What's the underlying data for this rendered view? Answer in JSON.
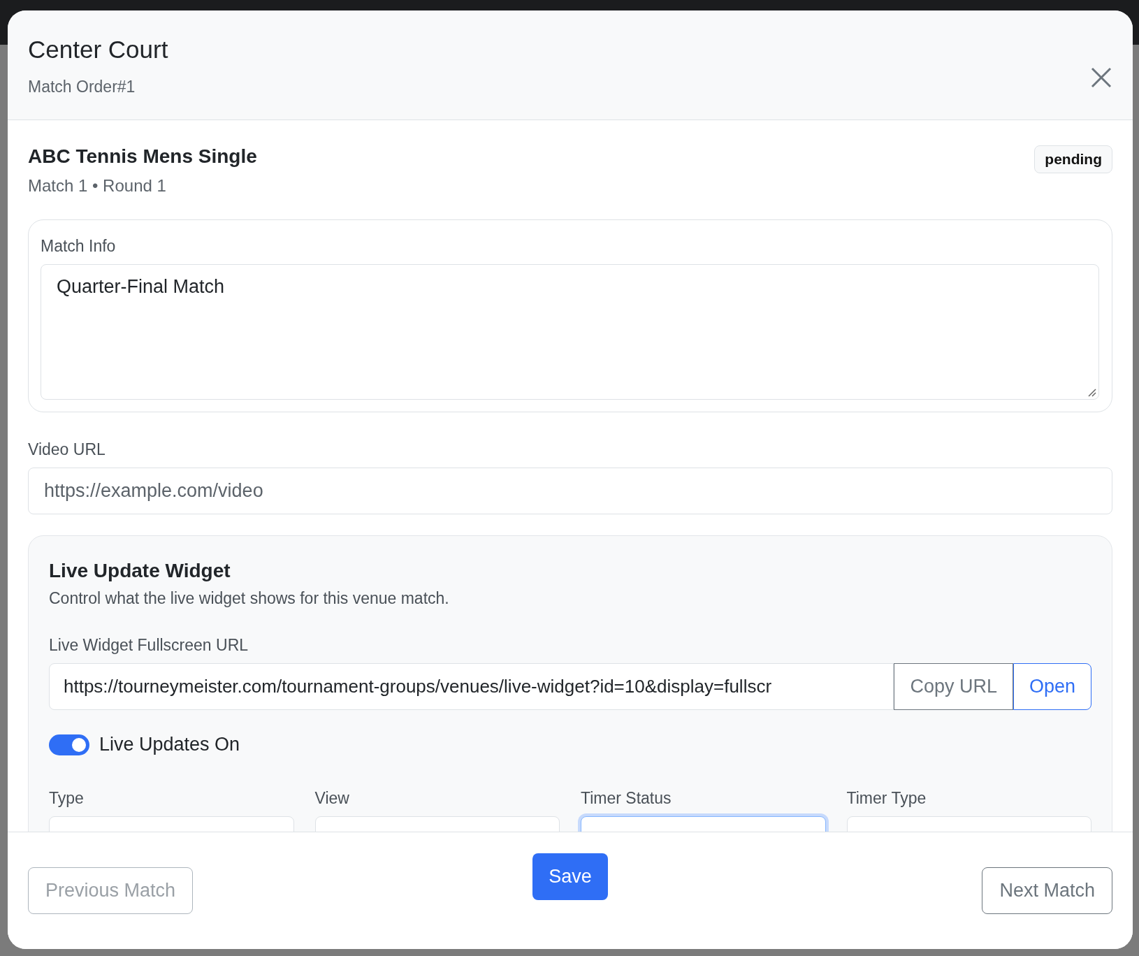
{
  "modal": {
    "title": "Center Court",
    "subtitle": "Match Order#1"
  },
  "match": {
    "event": "ABC Tennis Mens Single",
    "meta": "Match 1 • Round 1",
    "status": "pending"
  },
  "match_info": {
    "label": "Match Info",
    "value": "Quarter-Final Match"
  },
  "video_url": {
    "label": "Video URL",
    "placeholder": "https://example.com/video"
  },
  "widget": {
    "title": "Live Update Widget",
    "description": "Control what the live widget shows for this venue match.",
    "url_label": "Live Widget Fullscreen URL",
    "url": "https://tourneymeister.com/tournament-groups/venues/live-widget?id=10&display=fullscr",
    "copy_button": "Copy URL",
    "open_button": "Open",
    "toggle": {
      "label": "Live Updates On",
      "on": true
    },
    "selects": [
      {
        "label": "Type",
        "focused": false
      },
      {
        "label": "View",
        "focused": false
      },
      {
        "label": "Timer Status",
        "focused": true
      },
      {
        "label": "Timer Type",
        "focused": false
      }
    ]
  },
  "footer": {
    "previous": {
      "label": "Previous Match",
      "disabled": true
    },
    "save": "Save",
    "next": {
      "label": "Next Match",
      "disabled": false
    }
  }
}
